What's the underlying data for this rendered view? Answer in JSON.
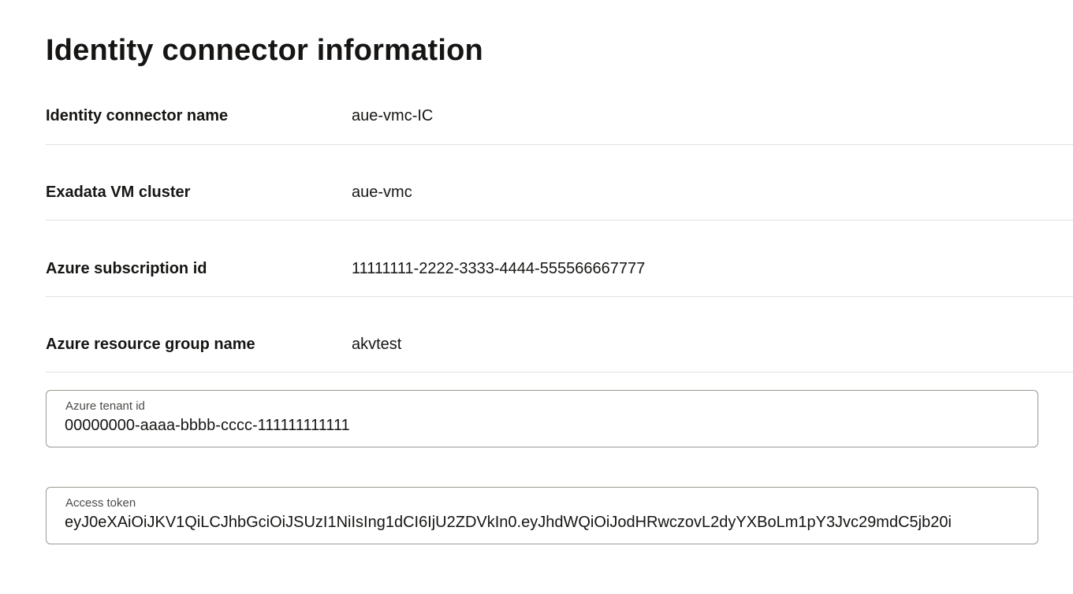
{
  "page_title": "Identity connector information",
  "rows": [
    {
      "label": "Identity connector name",
      "value": "aue-vmc-IC"
    },
    {
      "label": "Exadata VM cluster",
      "value": "aue-vmc"
    },
    {
      "label": "Azure subscription id",
      "value": "11111111-2222-3333-4444-555566667777"
    },
    {
      "label": "Azure resource group name",
      "value": "akvtest"
    }
  ],
  "fields": {
    "tenant": {
      "label": "Azure tenant id",
      "value": "00000000-aaaa-bbbb-cccc-111111111111"
    },
    "token": {
      "label": "Access token",
      "value": "eyJ0eXAiOiJKV1QiLCJhbGciOiJSUzI1NiIsIng1dCI6IjU2ZDVkIn0.eyJhdWQiOiJodHRwczovL2dyYXBoLm1pY3Jvc29mdC5jb20i"
    }
  }
}
